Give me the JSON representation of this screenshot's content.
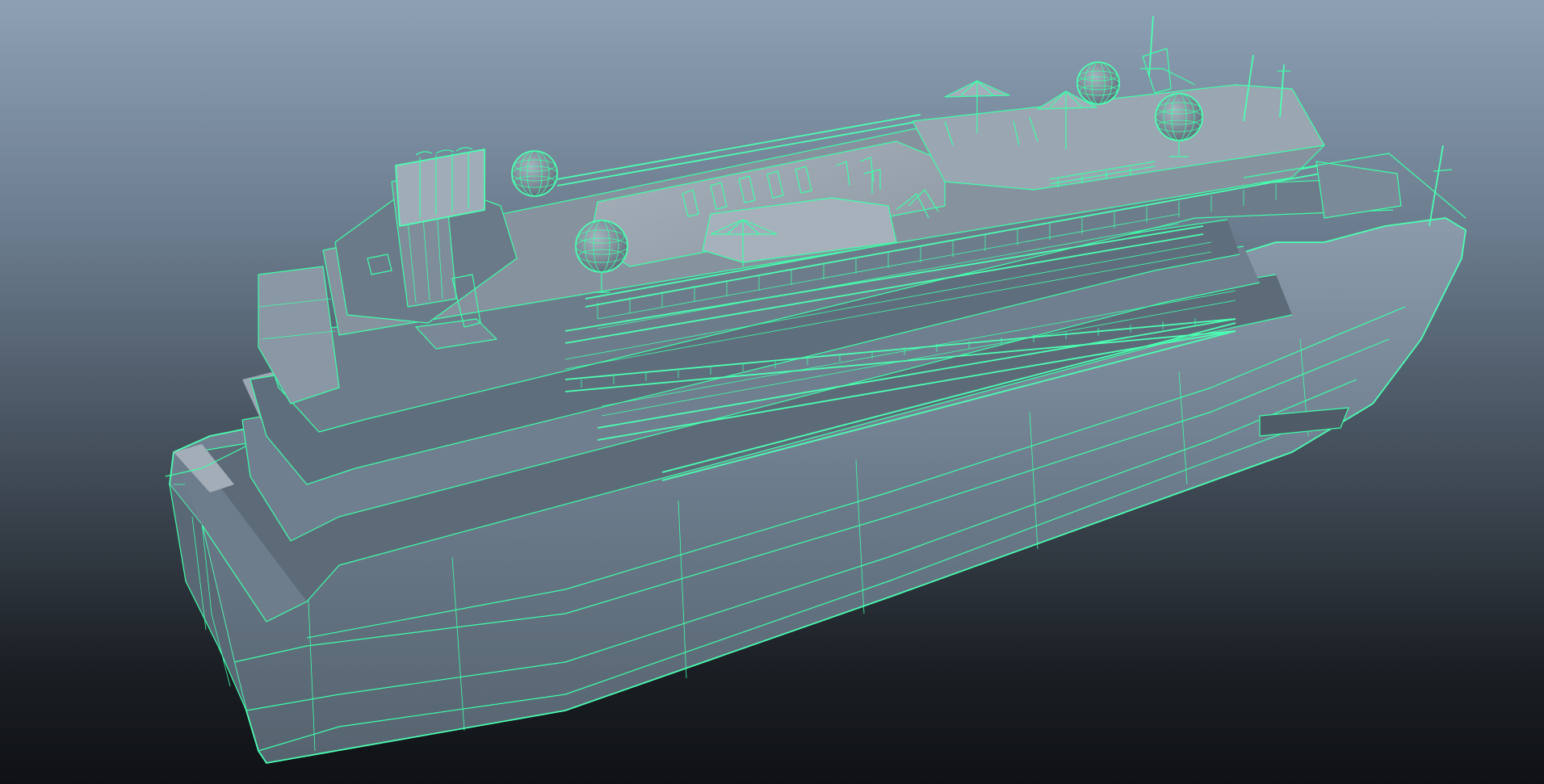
{
  "viewport": {
    "background_top": "#8da0b4",
    "background_bottom": "#0f1114",
    "wireframe_color": "#3dffa8",
    "shaded_surface": "#7d8e9f",
    "shaded_dark": "#4f5c69",
    "deck_color": "#9aa6b1"
  },
  "model": {
    "subject": "cruise-ship",
    "display_mode": "wireframe-on-shaded"
  }
}
